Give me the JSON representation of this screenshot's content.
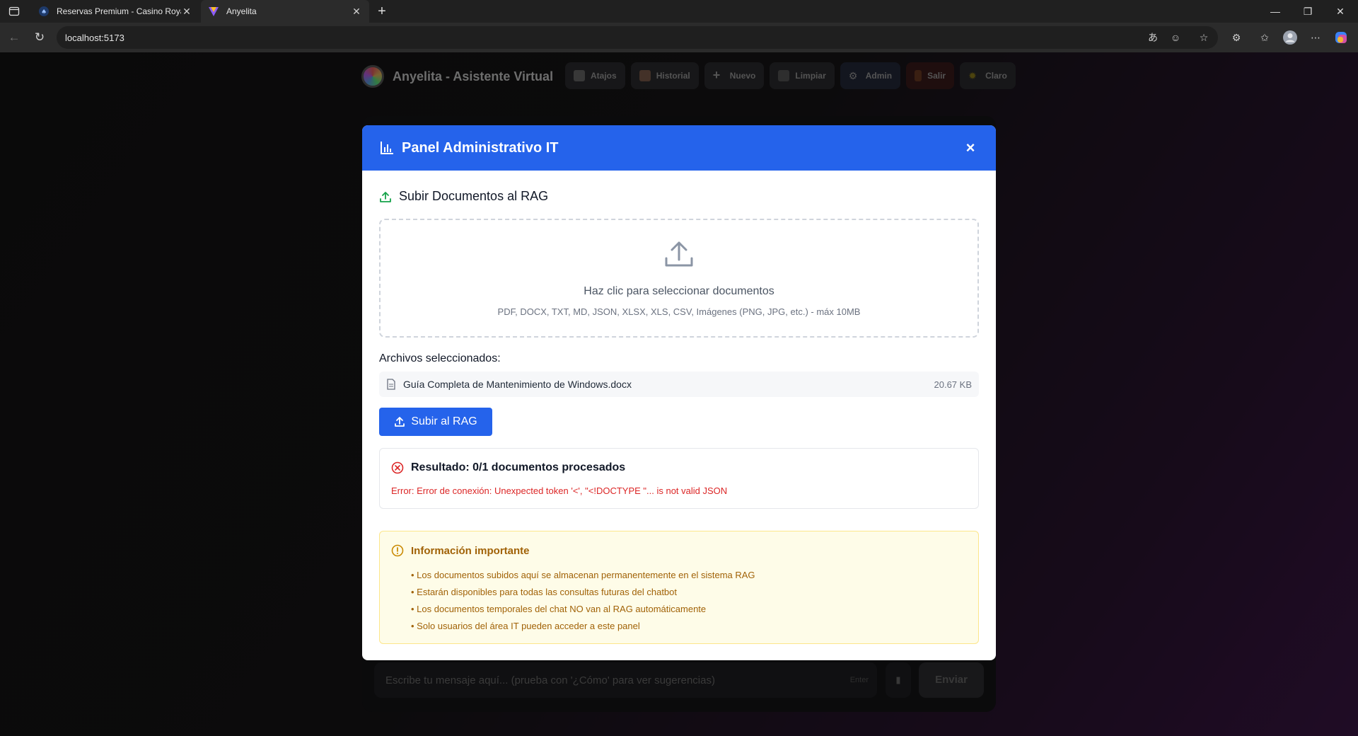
{
  "browser": {
    "tabs": [
      {
        "title": "Reservas Premium - Casino Royal",
        "active": false
      },
      {
        "title": "Anyelita",
        "active": true
      }
    ],
    "url": "localhost:5173",
    "new_tab": "+",
    "controls": {
      "minimize": "—",
      "restore": "❐",
      "close": "✕"
    }
  },
  "app": {
    "title": "Anyelita - Asistente Virtual",
    "header_buttons": [
      {
        "label": "Atajos",
        "icon": "keyboard-icon"
      },
      {
        "label": "Historial",
        "icon": "book-icon"
      },
      {
        "label": "Nuevo",
        "icon": "plus-icon"
      },
      {
        "label": "Limpiar",
        "icon": "trash-icon"
      },
      {
        "label": "Admin",
        "icon": "gear-icon"
      },
      {
        "label": "Salir",
        "icon": "door-icon"
      },
      {
        "label": "Claro",
        "icon": "sun-icon"
      }
    ],
    "chat": {
      "placeholder": "Escribe tu mensaje aquí... (prueba con '¿Cómo' para ver sugerencias)",
      "enter_hint": "Enter",
      "send_label": "Enviar"
    }
  },
  "modal": {
    "title": "Panel Administrativo IT",
    "close": "×",
    "section_title": "Subir Documentos al RAG",
    "dropzone": {
      "main": "Haz clic para seleccionar documentos",
      "sub": "PDF, DOCX, TXT, MD, JSON, XLSX, XLS, CSV, Imágenes (PNG, JPG, etc.) - máx 10MB"
    },
    "files_label": "Archivos seleccionados:",
    "files": [
      {
        "name": "Guía Completa de Mantenimiento de Windows.docx",
        "size": "20.67 KB"
      }
    ],
    "upload_button": "Subir al RAG",
    "result": {
      "title": "Resultado: 0/1 documentos procesados",
      "error": "Error: Error de conexión: Unexpected token '<', \"<!DOCTYPE \"... is not valid JSON"
    },
    "info": {
      "title": "Información importante",
      "items": [
        "• Los documentos subidos aquí se almacenan permanentemente en el sistema RAG",
        "• Estarán disponibles para todas las consultas futuras del chatbot",
        "• Los documentos temporales del chat NO van al RAG automáticamente",
        "• Solo usuarios del área IT pueden acceder a este panel"
      ]
    }
  },
  "colors": {
    "primary": "#2563eb",
    "error": "#dc2626",
    "warning_text": "#a16207",
    "warning_bg": "#fefce8"
  }
}
